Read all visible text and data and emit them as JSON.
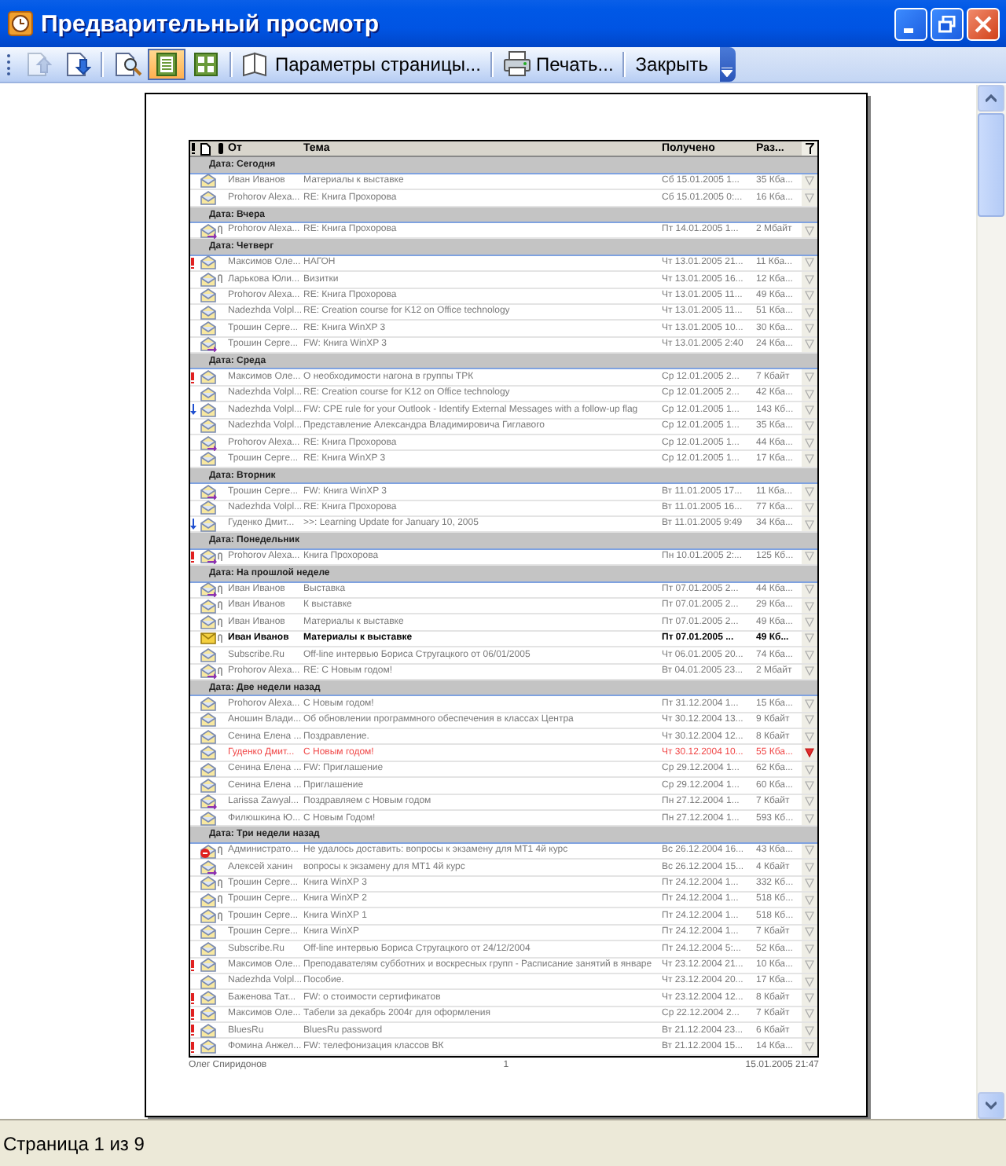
{
  "window": {
    "title": "Предварительный просмотр"
  },
  "toolbar": {
    "items": [
      {
        "kind": "prev-page",
        "disabled": true,
        "selected": false
      },
      {
        "kind": "next-page",
        "disabled": false,
        "selected": false
      },
      {
        "kind": "separator"
      },
      {
        "kind": "zoom",
        "disabled": false,
        "selected": false
      },
      {
        "kind": "one-page",
        "disabled": false,
        "selected": true
      },
      {
        "kind": "multi-page",
        "disabled": false,
        "selected": false
      },
      {
        "kind": "separator"
      },
      {
        "kind": "page-setup",
        "label": "Параметры страницы...",
        "disabled": false,
        "selected": false
      },
      {
        "kind": "separator"
      },
      {
        "kind": "print",
        "label": "Печать...",
        "disabled": false,
        "selected": false
      },
      {
        "kind": "separator"
      },
      {
        "kind": "text",
        "label": "Закрыть",
        "disabled": false,
        "selected": false
      }
    ]
  },
  "page": {
    "columns": [
      "От",
      "Тема",
      "Получено",
      "Раз..."
    ],
    "groups": [
      {
        "label": "Дата: Сегодня",
        "rows": [
          {
            "important": false,
            "low_priority": false,
            "kind": "read",
            "attachment": false,
            "unread": false,
            "flagged": false,
            "from": "Иван Иванов",
            "subject": "Материалы к выставке",
            "received": "Сб 15.01.2005 1...",
            "size": "35 Кба..."
          },
          {
            "important": false,
            "low_priority": false,
            "kind": "read",
            "attachment": false,
            "unread": false,
            "flagged": false,
            "from": "Prohorov Alexa...",
            "subject": "RE: Книга Прохорова",
            "received": "Сб 15.01.2005 0:...",
            "size": "16 Кба..."
          }
        ]
      },
      {
        "label": "Дата: Вчера",
        "rows": [
          {
            "important": false,
            "low_priority": false,
            "kind": "replied",
            "attachment": true,
            "unread": false,
            "flagged": false,
            "from": "Prohorov Alexa...",
            "subject": "RE: Книга Прохорова",
            "received": "Пт 14.01.2005 1...",
            "size": "2 Мбайт"
          }
        ]
      },
      {
        "label": "Дата: Четверг",
        "rows": [
          {
            "important": true,
            "low_priority": false,
            "kind": "read",
            "attachment": false,
            "unread": false,
            "flagged": false,
            "from": "Максимов Оле...",
            "subject": "НАГОН",
            "received": "Чт 13.01.2005 21...",
            "size": "11 Кба..."
          },
          {
            "important": false,
            "low_priority": false,
            "kind": "read",
            "attachment": true,
            "unread": false,
            "flagged": false,
            "from": "Ларькова Юли...",
            "subject": "Визитки",
            "received": "Чт 13.01.2005 16...",
            "size": "12 Кба..."
          },
          {
            "important": false,
            "low_priority": false,
            "kind": "read",
            "attachment": false,
            "unread": false,
            "flagged": false,
            "from": "Prohorov Alexa...",
            "subject": "RE: Книга Прохорова",
            "received": "Чт 13.01.2005 11...",
            "size": "49 Кба..."
          },
          {
            "important": false,
            "low_priority": false,
            "kind": "read",
            "attachment": false,
            "unread": false,
            "flagged": false,
            "from": "Nadezhda Volpl...",
            "subject": "RE: Creation course for K12 on Office technology",
            "received": "Чт 13.01.2005 11...",
            "size": "51 Кба..."
          },
          {
            "important": false,
            "low_priority": false,
            "kind": "read",
            "attachment": false,
            "unread": false,
            "flagged": false,
            "from": "Трошин Серге...",
            "subject": "RE: Книга WinXP 3",
            "received": "Чт 13.01.2005 10...",
            "size": "30 Кба..."
          },
          {
            "important": false,
            "low_priority": false,
            "kind": "replied",
            "attachment": false,
            "unread": false,
            "flagged": false,
            "from": "Трошин Серге...",
            "subject": "FW: Книга WinXP 3",
            "received": "Чт 13.01.2005 2:40",
            "size": "24 Кба..."
          }
        ]
      },
      {
        "label": "Дата: Среда",
        "rows": [
          {
            "important": true,
            "low_priority": false,
            "kind": "read",
            "attachment": false,
            "unread": false,
            "flagged": false,
            "from": "Максимов Оле...",
            "subject": "О необходимости нагона в группы ТРК",
            "received": "Ср 12.01.2005 2...",
            "size": "7 Кбайт"
          },
          {
            "important": false,
            "low_priority": false,
            "kind": "read",
            "attachment": false,
            "unread": false,
            "flagged": false,
            "from": "Nadezhda Volpl...",
            "subject": "RE: Creation course for K12 on Office technology",
            "received": "Ср 12.01.2005 2...",
            "size": "42 Кба..."
          },
          {
            "important": false,
            "low_priority": true,
            "kind": "read",
            "attachment": false,
            "unread": false,
            "flagged": false,
            "from": "Nadezhda Volpl...",
            "subject": "FW: CPE rule for your Outlook - Identify External Messages with a follow-up flag",
            "received": "Ср 12.01.2005 1...",
            "size": "143 Кб..."
          },
          {
            "important": false,
            "low_priority": false,
            "kind": "read",
            "attachment": false,
            "unread": false,
            "flagged": false,
            "from": "Nadezhda Volpl...",
            "subject": "Представление Александра Владимировича Гиглавого",
            "received": "Ср 12.01.2005 1...",
            "size": "35 Кба..."
          },
          {
            "important": false,
            "low_priority": false,
            "kind": "replied",
            "attachment": false,
            "unread": false,
            "flagged": false,
            "from": "Prohorov Alexa...",
            "subject": "RE: Книга Прохорова",
            "received": "Ср 12.01.2005 1...",
            "size": "44 Кба..."
          },
          {
            "important": false,
            "low_priority": false,
            "kind": "read",
            "attachment": false,
            "unread": false,
            "flagged": false,
            "from": "Трошин Серге...",
            "subject": "RE: Книга WinXP 3",
            "received": "Ср 12.01.2005 1...",
            "size": "17 Кба..."
          }
        ]
      },
      {
        "label": "Дата: Вторник",
        "rows": [
          {
            "important": false,
            "low_priority": false,
            "kind": "replied",
            "attachment": false,
            "unread": false,
            "flagged": false,
            "from": "Трошин Серге...",
            "subject": "FW: Книга WinXP 3",
            "received": "Вт 11.01.2005 17...",
            "size": "11 Кба..."
          },
          {
            "important": false,
            "low_priority": false,
            "kind": "read",
            "attachment": false,
            "unread": false,
            "flagged": false,
            "from": "Nadezhda Volpl...",
            "subject": "RE: Книга Прохорова",
            "received": "Вт 11.01.2005 16...",
            "size": "77 Кба..."
          },
          {
            "important": false,
            "low_priority": true,
            "kind": "read",
            "attachment": false,
            "unread": false,
            "flagged": false,
            "from": "Гуденко Дмит...",
            "subject": ">>: Learning Update for January 10, 2005",
            "received": "Вт 11.01.2005 9:49",
            "size": "34 Кба..."
          }
        ]
      },
      {
        "label": "Дата: Понедельник",
        "rows": [
          {
            "important": true,
            "low_priority": false,
            "kind": "replied",
            "attachment": true,
            "unread": false,
            "flagged": false,
            "from": "Prohorov Alexa...",
            "subject": "Книга Прохорова",
            "received": "Пн 10.01.2005 2:...",
            "size": "125 Кб..."
          }
        ]
      },
      {
        "label": "Дата: На прошлой неделе",
        "rows": [
          {
            "important": false,
            "low_priority": false,
            "kind": "replied",
            "attachment": true,
            "unread": false,
            "flagged": false,
            "from": "Иван Иванов",
            "subject": "Выставка",
            "received": "Пт 07.01.2005 2...",
            "size": "44 Кба..."
          },
          {
            "important": false,
            "low_priority": false,
            "kind": "read",
            "attachment": true,
            "unread": false,
            "flagged": false,
            "from": "Иван Иванов",
            "subject": "К выставке",
            "received": "Пт 07.01.2005 2...",
            "size": "29 Кба..."
          },
          {
            "important": false,
            "low_priority": false,
            "kind": "read",
            "attachment": true,
            "unread": false,
            "flagged": false,
            "from": "Иван Иванов",
            "subject": "Материалы к выставке",
            "received": "Пт 07.01.2005 2...",
            "size": "49 Кба..."
          },
          {
            "important": false,
            "low_priority": false,
            "kind": "unread",
            "attachment": true,
            "unread": true,
            "flagged": false,
            "from": "Иван Иванов",
            "subject": "Материалы к выставке",
            "received": "Пт 07.01.2005 ...",
            "size": "49 Кб..."
          },
          {
            "important": false,
            "low_priority": false,
            "kind": "read",
            "attachment": false,
            "unread": false,
            "flagged": false,
            "from": "Subscribe.Ru",
            "subject": "Off-line интервью Бориса Стругацкого от 06/01/2005",
            "received": "Чт 06.01.2005 20...",
            "size": "74 Кба..."
          },
          {
            "important": false,
            "low_priority": false,
            "kind": "replied",
            "attachment": true,
            "unread": false,
            "flagged": false,
            "from": "Prohorov Alexa...",
            "subject": "RE: С Новым годом!",
            "received": "Вт 04.01.2005 23...",
            "size": "2 Мбайт"
          }
        ]
      },
      {
        "label": "Дата: Две недели назад",
        "rows": [
          {
            "important": false,
            "low_priority": false,
            "kind": "read",
            "attachment": false,
            "unread": false,
            "flagged": false,
            "from": "Prohorov Alexa...",
            "subject": "С Новым годом!",
            "received": "Пт 31.12.2004 1...",
            "size": "15 Кба..."
          },
          {
            "important": false,
            "low_priority": false,
            "kind": "read",
            "attachment": false,
            "unread": false,
            "flagged": false,
            "from": "Аношин Влади...",
            "subject": "Об обновлении программного обеспечения в классах Центра",
            "received": "Чт 30.12.2004 13...",
            "size": "9 Кбайт"
          },
          {
            "important": false,
            "low_priority": false,
            "kind": "read",
            "attachment": false,
            "unread": false,
            "flagged": false,
            "from": "Сенина Елена ...",
            "subject": "Поздравление.",
            "received": "Чт 30.12.2004 12...",
            "size": "8 Кбайт"
          },
          {
            "important": false,
            "low_priority": false,
            "kind": "read",
            "attachment": false,
            "unread": false,
            "flagged": true,
            "from": "Гуденко Дмит...",
            "subject": "С Новым годом!",
            "received": "Чт 30.12.2004 10...",
            "size": "55 Кба..."
          },
          {
            "important": false,
            "low_priority": false,
            "kind": "read",
            "attachment": false,
            "unread": false,
            "flagged": false,
            "from": "Сенина Елена ...",
            "subject": "FW: Приглашение",
            "received": "Ср 29.12.2004 1...",
            "size": "62 Кба..."
          },
          {
            "important": false,
            "low_priority": false,
            "kind": "read",
            "attachment": false,
            "unread": false,
            "flagged": false,
            "from": "Сенина Елена ...",
            "subject": "Приглашение",
            "received": "Ср 29.12.2004 1...",
            "size": "60 Кба..."
          },
          {
            "important": false,
            "low_priority": false,
            "kind": "replied",
            "attachment": false,
            "unread": false,
            "flagged": false,
            "from": "Larissa Zawyal...",
            "subject": "Поздравляем с Новым годом",
            "received": "Пн 27.12.2004 1...",
            "size": "7 Кбайт"
          },
          {
            "important": false,
            "low_priority": false,
            "kind": "read",
            "attachment": false,
            "unread": false,
            "flagged": false,
            "from": "Филюшкина Ю...",
            "subject": "С Новым Годом!",
            "received": "Пн 27.12.2004 1...",
            "size": "593 Кб..."
          }
        ]
      },
      {
        "label": "Дата: Три недели назад",
        "rows": [
          {
            "important": false,
            "low_priority": false,
            "kind": "error",
            "attachment": true,
            "unread": false,
            "flagged": false,
            "from": "Администрато...",
            "subject": "Не удалось доставить: вопросы к экзамену для МТ1 4й курс",
            "received": "Вс 26.12.2004 16...",
            "size": "43 Кба..."
          },
          {
            "important": false,
            "low_priority": false,
            "kind": "replied",
            "attachment": false,
            "unread": false,
            "flagged": false,
            "from": "Алексей ханин",
            "subject": "вопросы к экзамену для МТ1 4й курс",
            "received": "Вс 26.12.2004 15...",
            "size": "4 Кбайт"
          },
          {
            "important": false,
            "low_priority": false,
            "kind": "read",
            "attachment": true,
            "unread": false,
            "flagged": false,
            "from": "Трошин Серге...",
            "subject": "Книга WinXP 3",
            "received": "Пт 24.12.2004 1...",
            "size": "332 Кб..."
          },
          {
            "important": false,
            "low_priority": false,
            "kind": "read",
            "attachment": true,
            "unread": false,
            "flagged": false,
            "from": "Трошин Серге...",
            "subject": "Книга WinXP 2",
            "received": "Пт 24.12.2004 1...",
            "size": "518 Кб..."
          },
          {
            "important": false,
            "low_priority": false,
            "kind": "read",
            "attachment": true,
            "unread": false,
            "flagged": false,
            "from": "Трошин Серге...",
            "subject": "Книга WinXP 1",
            "received": "Пт 24.12.2004 1...",
            "size": "518 Кб..."
          },
          {
            "important": false,
            "low_priority": false,
            "kind": "read",
            "attachment": false,
            "unread": false,
            "flagged": false,
            "from": "Трошин Серге...",
            "subject": "Книга WinXP",
            "received": "Пт 24.12.2004 1...",
            "size": "7 Кбайт"
          },
          {
            "important": false,
            "low_priority": false,
            "kind": "read",
            "attachment": false,
            "unread": false,
            "flagged": false,
            "from": "Subscribe.Ru",
            "subject": "Off-line интервью Бориса Стругацкого от 24/12/2004",
            "received": "Пт 24.12.2004 5:...",
            "size": "52 Кба..."
          },
          {
            "important": true,
            "low_priority": false,
            "kind": "read",
            "attachment": false,
            "unread": false,
            "flagged": false,
            "from": "Максимов Оле...",
            "subject": "Преподавателям субботних и воскресных групп - Расписание занятий в январе",
            "received": "Чт 23.12.2004 21...",
            "size": "10 Кба..."
          },
          {
            "important": false,
            "low_priority": false,
            "kind": "read",
            "attachment": false,
            "unread": false,
            "flagged": false,
            "from": "Nadezhda Volpl...",
            "subject": "Пособие.",
            "received": "Чт 23.12.2004 20...",
            "size": "17 Кба..."
          },
          {
            "important": true,
            "low_priority": false,
            "kind": "read",
            "attachment": false,
            "unread": false,
            "flagged": false,
            "from": "Баженова Тат...",
            "subject": "FW: о стоимости сертификатов",
            "received": "Чт 23.12.2004 12...",
            "size": "8 Кбайт"
          },
          {
            "important": true,
            "low_priority": false,
            "kind": "read",
            "attachment": false,
            "unread": false,
            "flagged": false,
            "from": "Максимов Оле...",
            "subject": "Табели за декабрь 2004г для оформления",
            "received": "Ср 22.12.2004 2...",
            "size": "7 Кбайт"
          },
          {
            "important": true,
            "low_priority": false,
            "kind": "read",
            "attachment": false,
            "unread": false,
            "flagged": false,
            "from": "BluesRu",
            "subject": "BluesRu password",
            "received": "Вт 21.12.2004 23...",
            "size": "6 Кбайт"
          },
          {
            "important": true,
            "low_priority": false,
            "kind": "read",
            "attachment": false,
            "unread": false,
            "flagged": false,
            "from": "Фомина Анжел...",
            "subject": "FW: телефонизация классов ВК",
            "received": "Вт 21.12.2004 15...",
            "size": "14 Кба..."
          }
        ]
      }
    ],
    "footer": {
      "author": "Олег Спиридонов",
      "page_number": "1",
      "date": "15.01.2005 21:47"
    }
  },
  "status_bar": {
    "text": "Страница 1 из 9"
  }
}
